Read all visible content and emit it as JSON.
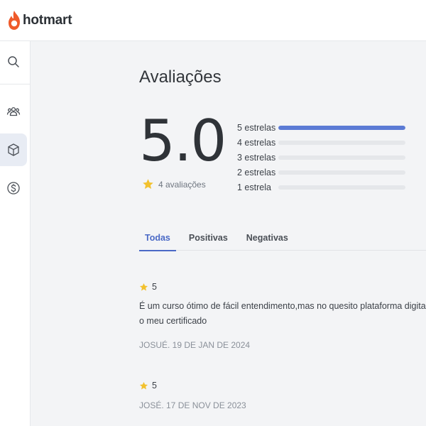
{
  "header": {
    "logo_text": "hotmart"
  },
  "sidebar": {
    "items": [
      {
        "name": "search",
        "icon": "search-icon",
        "active": false
      },
      {
        "name": "users",
        "icon": "users-icon",
        "active": false
      },
      {
        "name": "products",
        "icon": "box-icon",
        "active": true
      },
      {
        "name": "sales",
        "icon": "dollar-icon",
        "active": false
      }
    ]
  },
  "page": {
    "title": "Avaliações",
    "score": "5.0",
    "count_label": "4 avaliações"
  },
  "distribution": [
    {
      "label": "5 estrelas",
      "fraction": 1.0
    },
    {
      "label": "4 estrelas",
      "fraction": 0
    },
    {
      "label": "3 estrelas",
      "fraction": 0
    },
    {
      "label": "2 estrelas",
      "fraction": 0
    },
    {
      "label": "1 estrela",
      "fraction": 0
    }
  ],
  "tabs": [
    {
      "label": "Todas",
      "active": true
    },
    {
      "label": "Positivas",
      "active": false
    },
    {
      "label": "Negativas",
      "active": false
    }
  ],
  "reviews": [
    {
      "rating": "5",
      "text_line1": "É um curso ótimo de fácil entendimento,mas no quesito plataforma digital tem mui",
      "text_line2": "o meu certificado",
      "meta": "JOSUÉ. 19 DE JAN DE 2024"
    },
    {
      "rating": "5",
      "meta": "JOSÉ. 17 DE NOV DE 2023"
    }
  ],
  "colors": {
    "accent": "#4a69c6",
    "bar_fill": "#5b7bd5",
    "star": "#f2c12e",
    "logo_flame": "#ef5a2a"
  }
}
